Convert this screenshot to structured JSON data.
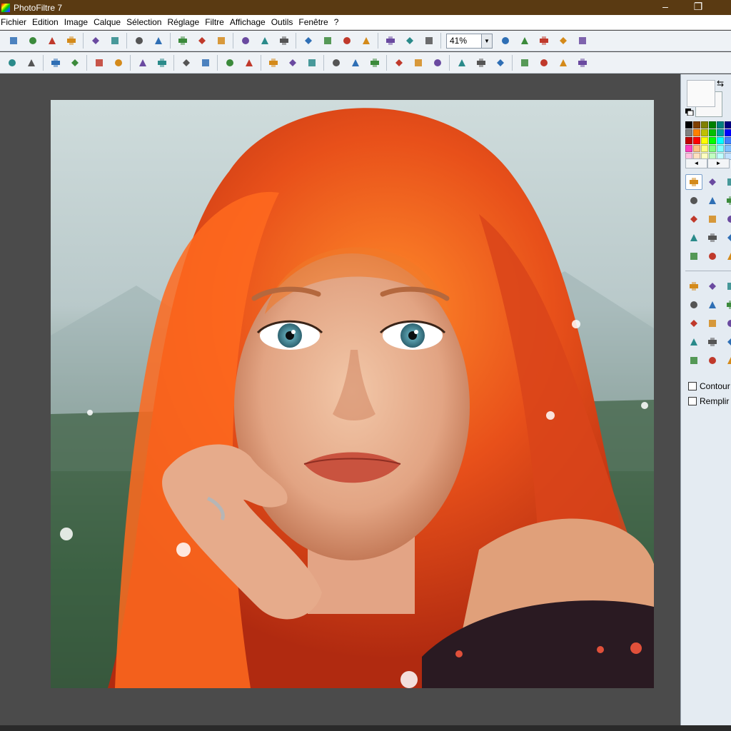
{
  "window": {
    "title": "PhotoFiltre 7",
    "minimize": "–",
    "maximize": "❐"
  },
  "menu": [
    "Fichier",
    "Edition",
    "Image",
    "Calque",
    "Sélection",
    "Réglage",
    "Filtre",
    "Affichage",
    "Outils",
    "Fenêtre",
    "?"
  ],
  "toolbar1": {
    "group1": [
      "new-icon",
      "open-icon",
      "save-icon",
      "save-as-icon"
    ],
    "group2": [
      "print-icon",
      "scan-icon"
    ],
    "group3": [
      "undo-icon",
      "redo-icon"
    ],
    "group4": [
      "paste-layer-icon",
      "duplicate-icon",
      "layer-icon"
    ],
    "group5": [
      "rect-image-icon",
      "color-grid-icon",
      "mask-icon"
    ],
    "group6": [
      "image-size-icon",
      "canvas-size-icon",
      "crop-icon",
      "text-icon"
    ],
    "group7": [
      "explorer-icon",
      "automation-icon",
      "batch-icon"
    ],
    "zoom": {
      "value": "41%"
    },
    "group8": [
      "zoom-in-icon",
      "zoom-out-icon",
      "fit-window-icon",
      "actual-size-icon",
      "fullscreen-icon"
    ]
  },
  "toolbar2": {
    "group1": [
      "brightness-plus-icon",
      "brightness-minus-icon"
    ],
    "group2": [
      "contrast-minus-icon",
      "contrast-plus-icon"
    ],
    "group3": [
      "gamma-minus-icon",
      "gamma-plus-icon"
    ],
    "group4": [
      "saturation-minus-icon",
      "saturation-plus-icon"
    ],
    "group5": [
      "color-balance-icon",
      "levels-icon"
    ],
    "group6": [
      "auto-levels-icon",
      "auto-contrast-icon"
    ],
    "group7": [
      "grid-icon",
      "dither-icon",
      "pattern-icon"
    ],
    "group8": [
      "grayscale-icon",
      "blur-icon",
      "sharpen-icon"
    ],
    "group9": [
      "emboss-icon",
      "soften-icon",
      "sharpen-more-icon"
    ],
    "group10": [
      "gradient-icon",
      "fade-icon",
      "transparency-icon"
    ],
    "group11": [
      "flip-h-icon",
      "flip-v-icon",
      "rotate-left-icon",
      "rotate-right-icon"
    ]
  },
  "palette": {
    "swatches": [
      "#000000",
      "#804000",
      "#808000",
      "#008000",
      "#008080",
      "#000080",
      "#800080",
      "#808080",
      "#ff8000",
      "#c0c000",
      "#00c000",
      "#00a0a0",
      "#0000ff",
      "#c000c0",
      "#c00000",
      "#ff0000",
      "#ffff00",
      "#00ff00",
      "#00ffff",
      "#4080ff",
      "#ff00ff",
      "#ff40c0",
      "#ffc080",
      "#ffff80",
      "#80ff80",
      "#80ffff",
      "#80c0ff",
      "#ff80ff",
      "#ffc0e0",
      "#ffe0c0",
      "#ffffc0",
      "#c0ffc0",
      "#c0ffff",
      "#c0e0ff",
      "#e0c0ff"
    ]
  },
  "tools": [
    "selection-arrow-icon",
    "layer-manager-icon",
    "hand-icon",
    "eyedropper-icon",
    "magic-wand-icon",
    "line-icon",
    "fill-bucket-icon",
    "spray-icon",
    "eraser-icon",
    "brush-icon",
    "pencil-icon",
    "smudge-icon",
    "drop-icon",
    "finger-icon",
    "stamp-icon"
  ],
  "shapes": [
    "rectangle-icon",
    "ellipse-icon",
    "rounded-rect-icon",
    "diamond-icon",
    "triangle-icon",
    "square-select-icon",
    "lasso-icon",
    "polygon-icon",
    "magic-selection-icon",
    "equal-icon",
    "ratio-icon",
    "marquee-icon",
    "text-select-icon",
    "transform-icon",
    "page-icon"
  ],
  "options": {
    "contour": "Contour",
    "remplir": "Remplir"
  }
}
